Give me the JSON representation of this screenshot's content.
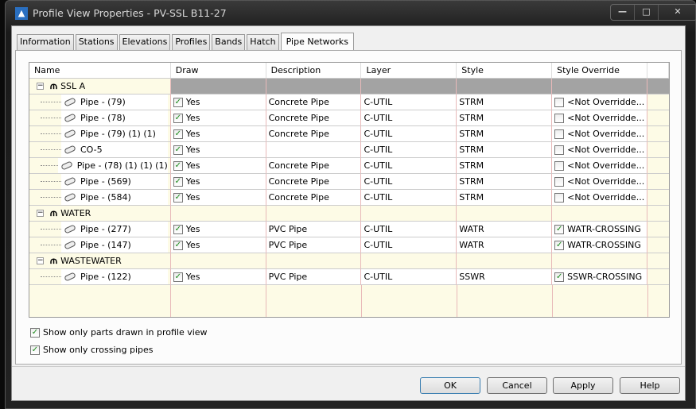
{
  "window": {
    "title": "Profile View Properties - PV-SSL B11-27"
  },
  "tabs": [
    "Information",
    "Stations",
    "Elevations",
    "Profiles",
    "Bands",
    "Hatch",
    "Pipe Networks"
  ],
  "grid": {
    "headers": [
      "Name",
      "Draw",
      "Description",
      "Layer",
      "Style",
      "Style Override"
    ],
    "rows": [
      {
        "type": "network",
        "name": "SSL A",
        "selected": true
      },
      {
        "type": "part",
        "name": "Pipe - (79)",
        "draw": "Yes",
        "desc": "Concrete Pipe",
        "layer": "C-UTIL",
        "style": "STRM",
        "override": "<Not Overridde...",
        "ov": false
      },
      {
        "type": "part",
        "name": "Pipe - (78)",
        "draw": "Yes",
        "desc": "Concrete Pipe",
        "layer": "C-UTIL",
        "style": "STRM",
        "override": "<Not Overridde...",
        "ov": false
      },
      {
        "type": "part",
        "name": "Pipe - (79) (1) (1)",
        "draw": "Yes",
        "desc": "Concrete Pipe",
        "layer": "C-UTIL",
        "style": "STRM",
        "override": "<Not Overridde...",
        "ov": false
      },
      {
        "type": "part",
        "name": "CO-5",
        "draw": "Yes",
        "desc": "",
        "layer": "C-UTIL",
        "style": "STRM",
        "override": "<Not Overridde...",
        "ov": false
      },
      {
        "type": "part",
        "name": "Pipe - (78) (1) (1) (1)",
        "draw": "Yes",
        "desc": "Concrete Pipe",
        "layer": "C-UTIL",
        "style": "STRM",
        "override": "<Not Overridde...",
        "ov": false
      },
      {
        "type": "part",
        "name": "Pipe - (569)",
        "draw": "Yes",
        "desc": "Concrete Pipe",
        "layer": "C-UTIL",
        "style": "STRM",
        "override": "<Not Overridde...",
        "ov": false
      },
      {
        "type": "part",
        "name": "Pipe - (584)",
        "draw": "Yes",
        "desc": "Concrete Pipe",
        "layer": "C-UTIL",
        "style": "STRM",
        "override": "<Not Overridde...",
        "ov": false
      },
      {
        "type": "network",
        "name": "WATER"
      },
      {
        "type": "part",
        "name": "Pipe - (277)",
        "draw": "Yes",
        "desc": "PVC Pipe",
        "layer": "C-UTIL",
        "style": "WATR",
        "override": "WATR-CROSSING",
        "ov": true
      },
      {
        "type": "part",
        "name": "Pipe - (147)",
        "draw": "Yes",
        "desc": "PVC Pipe",
        "layer": "C-UTIL",
        "style": "WATR",
        "override": "WATR-CROSSING",
        "ov": true
      },
      {
        "type": "network",
        "name": "WASTEWATER"
      },
      {
        "type": "part",
        "name": "Pipe - (122)",
        "draw": "Yes",
        "desc": "PVC Pipe",
        "layer": "C-UTIL",
        "style": "SSWR",
        "override": "SSWR-CROSSING",
        "ov": true
      }
    ]
  },
  "options": {
    "parts_drawn": "Show only parts drawn in profile view",
    "crossing": "Show only crossing pipes"
  },
  "buttons": {
    "ok": "OK",
    "cancel": "Cancel",
    "apply": "Apply",
    "help": "Help"
  }
}
